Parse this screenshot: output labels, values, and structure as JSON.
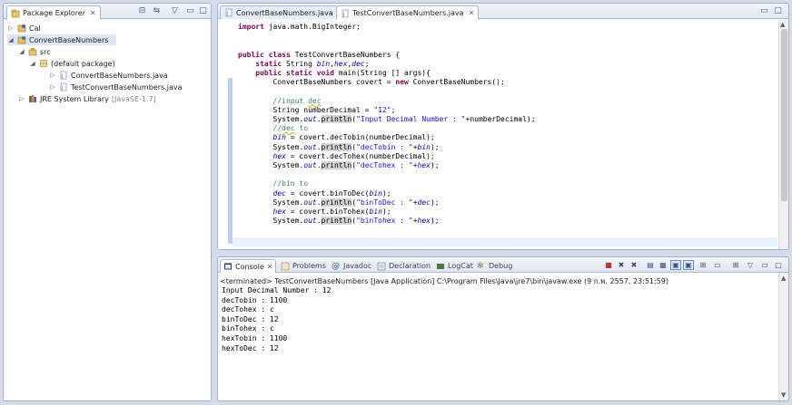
{
  "package_explorer": {
    "tab_label": "Package Explorer",
    "tree": [
      {
        "label": "Cal",
        "extra": ""
      },
      {
        "label": "ConvertBaseNumbers",
        "extra": ""
      },
      {
        "label": "src",
        "extra": ""
      },
      {
        "label": "(default package)",
        "extra": ""
      },
      {
        "label": "ConvertBaseNumbers.java",
        "extra": ""
      },
      {
        "label": "TestConvertBaseNumbers.java",
        "extra": ""
      },
      {
        "label": "JRE System Library",
        "extra": "[JavaSE-1.7]"
      }
    ]
  },
  "editor": {
    "tabs": [
      {
        "label": "ConvertBaseNumbers.java"
      },
      {
        "label": "TestConvertBaseNumbers.java"
      }
    ]
  },
  "console": {
    "tabs": [
      {
        "label": "Console"
      },
      {
        "label": "Problems"
      },
      {
        "label": "Javadoc"
      },
      {
        "label": "Declaration"
      },
      {
        "label": "LogCat"
      },
      {
        "label": "Debug"
      }
    ],
    "terminated": "<terminated> TestConvertBaseNumbers [Java Application] C:\\Program Files\\Java\\jre7\\bin\\javaw.exe (9 ก.พ. 2557, 23:51:59)",
    "output": [
      "Input Decimal Number : 12",
      "decTobin : 1100",
      "decTohex : c",
      "binToDec : 12",
      "binTohex : c",
      "hexTobin : 1100",
      "hexToDec : 12"
    ]
  },
  "colors": {
    "keyword": "#7f0055",
    "field": "#0000c0",
    "string": "#2a00ff",
    "comment": "#3f7f5f",
    "selection": "#dde6f5"
  }
}
